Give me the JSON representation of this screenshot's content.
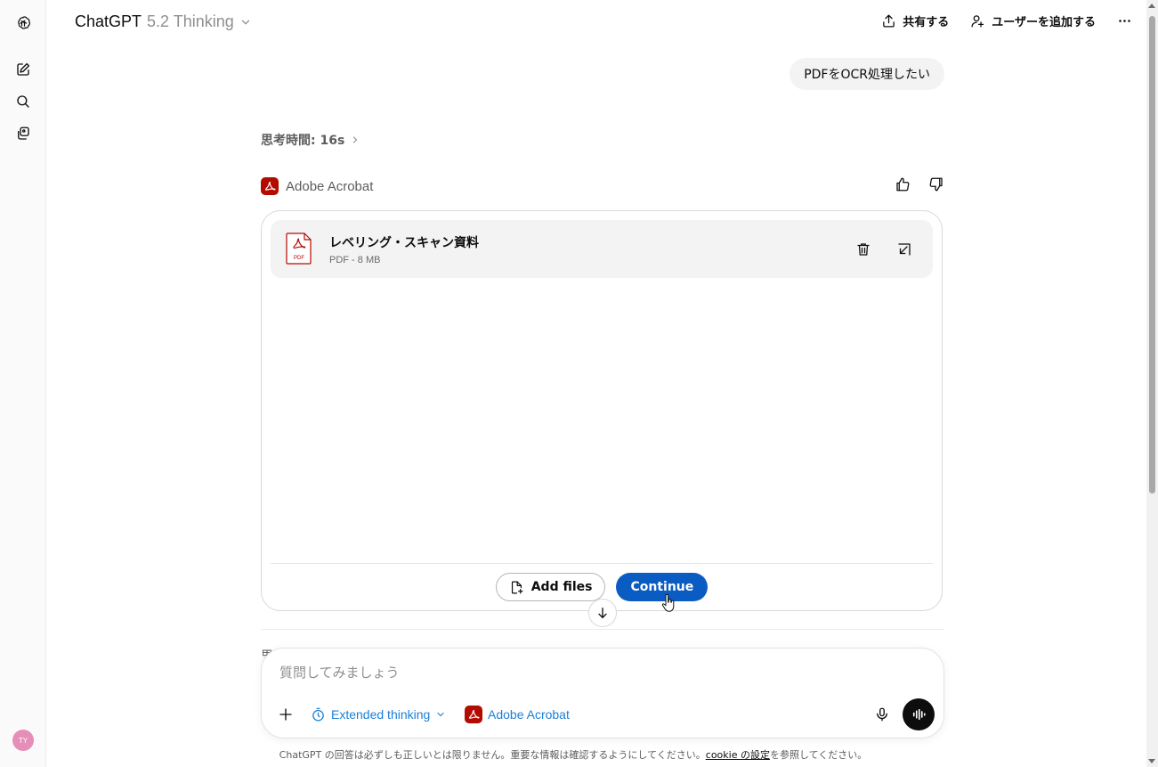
{
  "header": {
    "model_name": "ChatGPT",
    "model_version": "5.2 Thinking",
    "share_label": "共有する",
    "add_user_label": "ユーザーを追加する",
    "more_icon": "more-horizontal-icon"
  },
  "sidebar": {
    "items": [
      {
        "name": "openai-logo-icon"
      },
      {
        "name": "new-chat-icon"
      },
      {
        "name": "search-icon"
      },
      {
        "name": "library-icon"
      }
    ],
    "avatar_initials": "TY",
    "avatar_color": "#e58fb8"
  },
  "conversation": {
    "user_message": "PDFをOCR処理したい",
    "thinking_label": "思考時間: 16s",
    "peek_text": "思"
  },
  "app": {
    "name": "Adobe Acrobat",
    "brand_color": "#b30b00"
  },
  "card": {
    "file": {
      "name": "レベリング・スキャン資料",
      "meta": "PDF - 8 MB",
      "icon_label": "PDF"
    },
    "add_files_label": "Add files",
    "continue_label": "Continue",
    "continue_color": "#0b5cc2"
  },
  "composer": {
    "placeholder": "質問してみましょう",
    "extended_thinking_label": "Extended thinking",
    "app_label": "Adobe Acrobat",
    "pill_color": "#1c7fd6"
  },
  "footer": {
    "disclaimer_pre": "ChatGPT の回答は必ずしも正しいとは限りません。重要な情報は確認するようにしてください。",
    "cookie_link": "cookie の設定",
    "disclaimer_post": "を参照してください。"
  }
}
